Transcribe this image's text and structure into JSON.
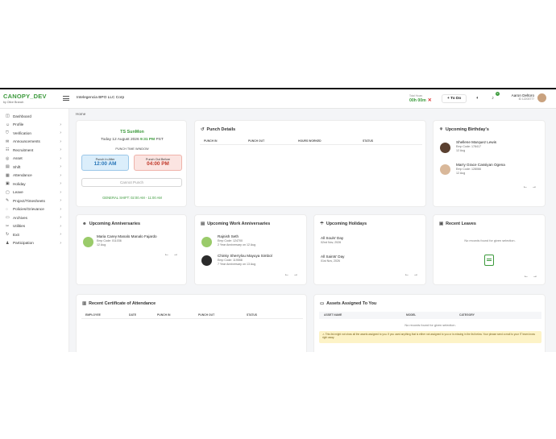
{
  "app": {
    "name": "CANOPY_DEV",
    "tagline": "by Olive Branch"
  },
  "header": {
    "company": "Intelegencia BPO LLC Corp",
    "timer_label": "Total Hours",
    "timer_value": "00h 00m",
    "todo_label": "+ To Do",
    "notification_count": "0",
    "user_name": "Aaron Deltoro",
    "user_id": "ID 12203777"
  },
  "sidebar": {
    "items": [
      {
        "label": "Dashboard",
        "icon": "dashboard-icon",
        "glyph": "◫",
        "chevron": false
      },
      {
        "label": "Profile",
        "icon": "profile-icon",
        "glyph": "☺",
        "chevron": true
      },
      {
        "label": "Verification",
        "icon": "verification-icon",
        "glyph": "⛉",
        "chevron": true
      },
      {
        "label": "Announcements",
        "icon": "announcements-icon",
        "glyph": "✉",
        "chevron": true
      },
      {
        "label": "Recruitment",
        "icon": "recruitment-icon",
        "glyph": "☷",
        "chevron": true
      },
      {
        "label": "Asset",
        "icon": "asset-icon",
        "glyph": "◎",
        "chevron": true
      },
      {
        "label": "Shift",
        "icon": "shift-icon",
        "glyph": "▤",
        "chevron": true
      },
      {
        "label": "Attendance",
        "icon": "attendance-icon",
        "glyph": "▦",
        "chevron": true
      },
      {
        "label": "Holiday",
        "icon": "holiday-icon",
        "glyph": "▣",
        "chevron": true
      },
      {
        "label": "Leave",
        "icon": "leave-icon",
        "glyph": "▢",
        "chevron": true
      },
      {
        "label": "Project/Timesheets",
        "icon": "project-icon",
        "glyph": "✎",
        "chevron": true
      },
      {
        "label": "Policies/Grievance",
        "icon": "policies-icon",
        "glyph": "◌",
        "chevron": true
      },
      {
        "label": "Archives",
        "icon": "archives-icon",
        "glyph": "▭",
        "chevron": true
      },
      {
        "label": "Utilities",
        "icon": "utilities-icon",
        "glyph": "✂",
        "chevron": true
      },
      {
        "label": "Exit",
        "icon": "exit-icon",
        "glyph": "↻",
        "chevron": true
      },
      {
        "label": "Participation",
        "icon": "participation-icon",
        "glyph": "♟",
        "chevron": true
      }
    ]
  },
  "breadcrumb": "Home",
  "shift": {
    "name": "TS SunMon",
    "date": "Today 12 August 2026",
    "time": "9:31 PM",
    "tz": "PST",
    "window_label": "PUNCH TIME WINDOW",
    "in_label": "Punch In After",
    "in_time": "12:00 AM",
    "out_label": "Punch Out Before",
    "out_time": "04:00 PM",
    "button": "Cannot Punch",
    "general": "GENERAL SHIFT: 02:00 AM - 11:00 AM"
  },
  "punch": {
    "title": "Punch Details",
    "cols": [
      "PUNCH IN",
      "PUNCH OUT",
      "HOURS WORKED",
      "STATUS"
    ]
  },
  "birthdays": {
    "title": "Upcoming Birthday's",
    "people": [
      {
        "name": "Shellene Marquez Lewis",
        "code": "Emp Code: 178417",
        "date": "12 Aug"
      },
      {
        "name": "Marry Grace Cassiyan Ogena",
        "code": "Emp Code: 128066",
        "date": "12 Aug"
      }
    ]
  },
  "anniversaries": {
    "title": "Upcoming Anniversaries",
    "people": [
      {
        "name": "Maria Carey Manalo Manalo Fajardo",
        "code": "Emp Code: 011036",
        "date": "12 Aug"
      }
    ]
  },
  "work_anniversaries": {
    "title": "Upcoming Work Anniversaries",
    "people": [
      {
        "name": "Rajnish Seth",
        "code": "Emp Code: 124700",
        "date": "2 Year Anniversary on 12 Aug"
      },
      {
        "name": "Chinky Sherrylou Mayuya Simbol",
        "code": "Emp Code: 119558",
        "date": "7 Year Anniversary on 13 Aug"
      }
    ]
  },
  "holidays": {
    "title": "Upcoming Holidays",
    "items": [
      {
        "name": "All Souls' Day",
        "date": "02nd Nov, 2026"
      },
      {
        "name": "All Saints' Day",
        "date": "01st Nov, 2026"
      }
    ]
  },
  "leaves": {
    "title": "Recent Leaves",
    "empty": "No records found for given selection."
  },
  "certificate": {
    "title": "Recent Certificate of Attendance",
    "cols": [
      "EMPLOYEE",
      "DATE",
      "PUNCH IN",
      "PUNCH OUT",
      "STATUS"
    ]
  },
  "assets": {
    "title": "Assets Assigned To You",
    "cols": [
      "ASSET NAME",
      "MODEL",
      "CATEGORY"
    ],
    "empty": "No records found for given selection.",
    "notice": "⚠ This list might not show all the assets assigned to you. If you used anything that is either not assigned to you or is missing in the list below. Your please send a mail to your IT team know right away."
  },
  "colors": {
    "brand": "#3c9a3c",
    "punch_in_bg": "#dbeefb",
    "punch_out_bg": "#fbe4e1"
  }
}
